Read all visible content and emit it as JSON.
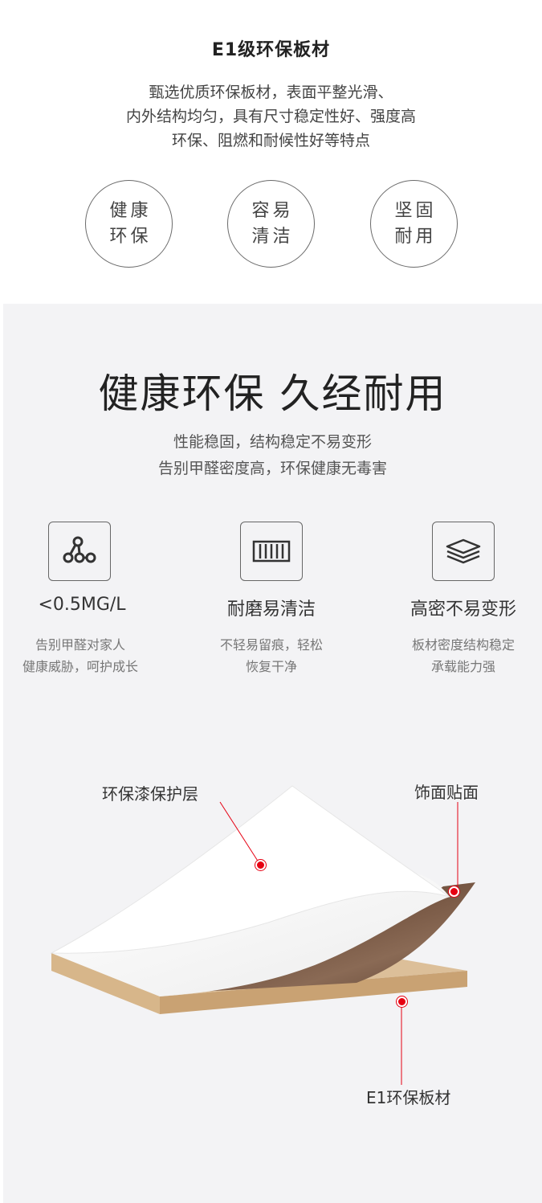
{
  "top": {
    "title": "E1级环保板材",
    "desc": [
      "甄选优质环保板材，表面平整光滑、",
      "内外结构均匀，具有尺寸稳定性好、强度高",
      "环保、阻燃和耐候性好等特点"
    ],
    "circles": [
      {
        "line1": "健康",
        "line2": "环保"
      },
      {
        "line1": "容易",
        "line2": "清洁"
      },
      {
        "line1": "坚固",
        "line2": "耐用"
      }
    ]
  },
  "main": {
    "title": "健康环保 久经耐用",
    "desc": [
      "性能稳固，结构稳定不易变形",
      "告别甲醛密度高，环保健康无毒害"
    ],
    "features": [
      {
        "icon": "molecule-icon",
        "title": "<0.5MG/L",
        "desc": [
          "告别甲醛对家人",
          "健康威胁，呵护成长"
        ]
      },
      {
        "icon": "board-grid-icon",
        "title": "耐磨易清洁",
        "desc": [
          "不轻易留痕，轻松",
          "恢复干净"
        ]
      },
      {
        "icon": "layers-icon",
        "title": "高密不易变形",
        "desc": [
          "板材密度结构稳定",
          "承载能力强"
        ]
      }
    ]
  },
  "diagram": {
    "label_lacquer": "环保漆保护层",
    "label_veneer": "饰面贴面",
    "label_board": "E1环保板材"
  },
  "colors": {
    "accent_red": "#e60012",
    "bottom_bg": "#f3f3f5",
    "board_core": "#d9b68a",
    "veneer": "#7a5a44"
  }
}
